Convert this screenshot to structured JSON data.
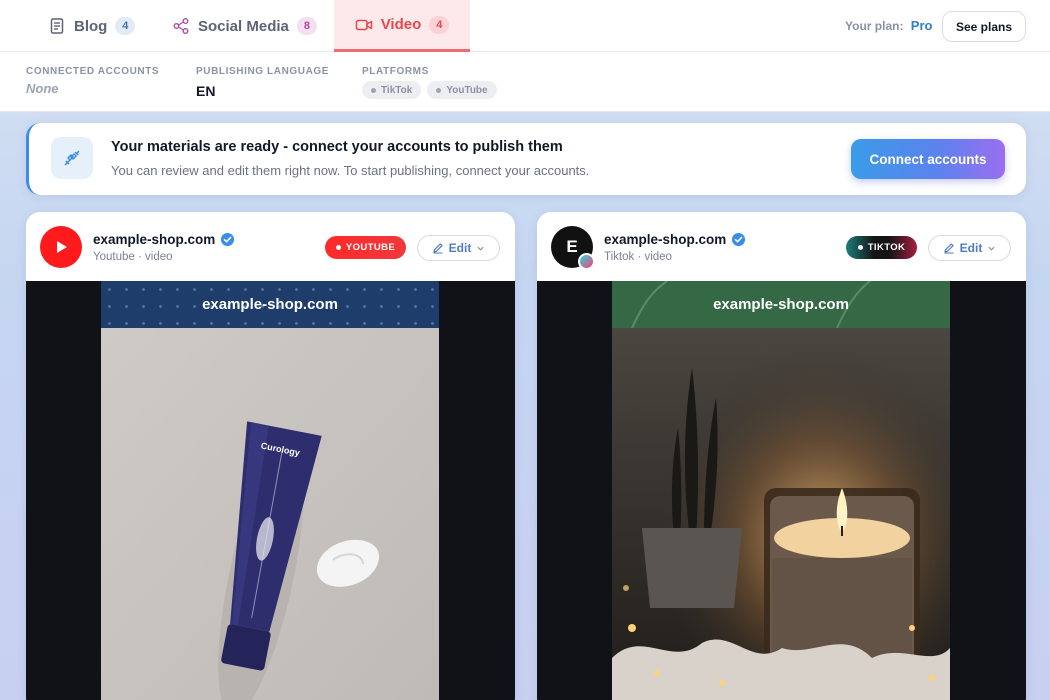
{
  "nav": {
    "tabs": [
      {
        "label": "Blog",
        "count": "4"
      },
      {
        "label": "Social Media",
        "count": "8"
      },
      {
        "label": "Video",
        "count": "4"
      }
    ],
    "plan_label": "Your plan:",
    "plan_name": "Pro",
    "see_plans": "See plans"
  },
  "info": {
    "connected_label": "CONNECTED ACCOUNTS",
    "connected_value": "None",
    "language_label": "PUBLISHING LANGUAGE",
    "language_value": "EN",
    "platforms_label": "PLATFORMS",
    "platforms": [
      "TikTok",
      "YouTube"
    ]
  },
  "banner": {
    "title": "Your materials are ready - connect your accounts to publish them",
    "subtitle": "You can review and edit them right now. To start publishing, connect your accounts.",
    "button": "Connect accounts"
  },
  "cards": [
    {
      "account": "example-shop.com",
      "sub": "Youtube · video",
      "platform": "YOUTUBE",
      "edit": "Edit",
      "overlay": "example-shop.com",
      "product_text": "Curology"
    },
    {
      "account": "example-shop.com",
      "avatar_letter": "E",
      "sub": "Tiktok · video",
      "platform": "TIKTOK",
      "edit": "Edit",
      "overlay": "example-shop.com"
    }
  ],
  "colors": {
    "accent_video": "#e5484d",
    "youtube_red": "#ff1b1b",
    "link_blue": "#2f80d0"
  }
}
